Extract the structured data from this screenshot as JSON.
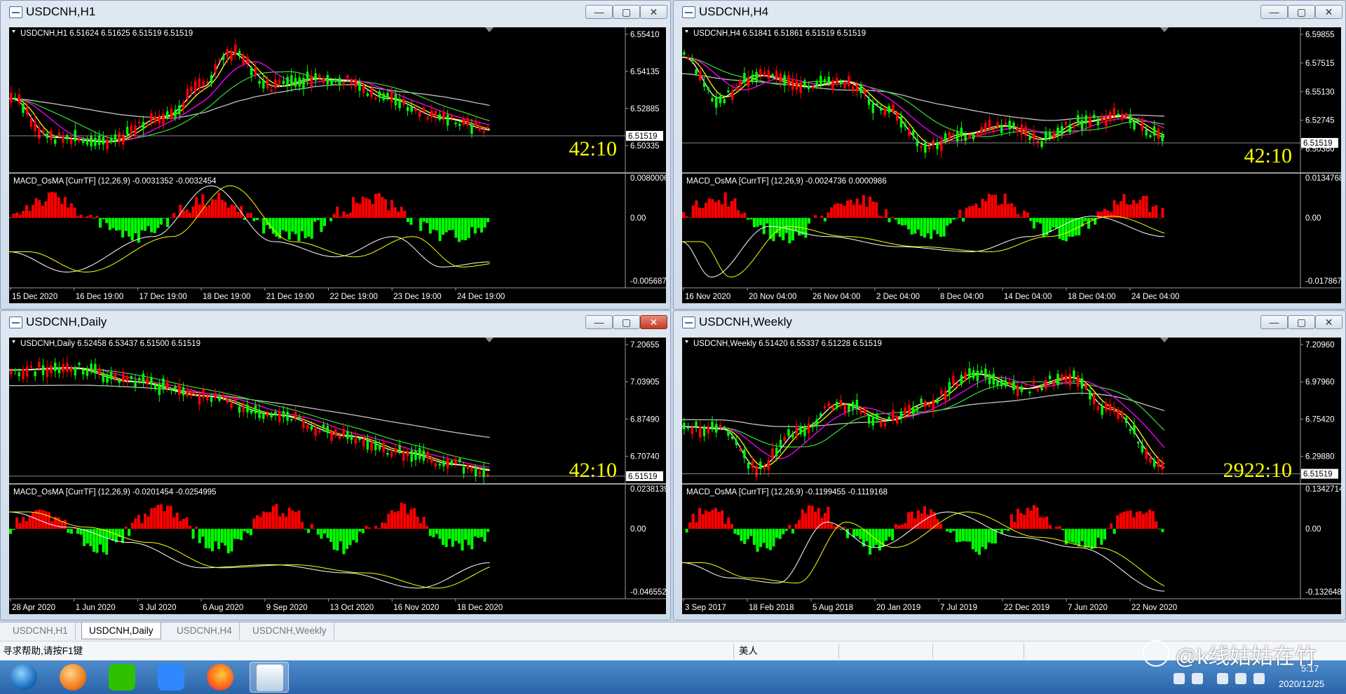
{
  "colors": {
    "bull": "#ff0000",
    "bear": "#00ff00",
    "sma_fast": "#ffffff",
    "sma_yellow": "#ffff00",
    "sma_magenta": "#ff00ff",
    "sma_green": "#32cd32",
    "sma_slow": "#c0c0c0",
    "countdown": "#ffff00"
  },
  "windows": [
    {
      "id": "h1",
      "title": "USDCNH,H1",
      "price_header": "USDCNH,H1  6.51624 6.51625 6.51519 6.51519",
      "price_ticks": [
        "6.55410",
        "6.54135",
        "6.52885",
        "6.50335"
      ],
      "last_price": "6.51519",
      "countdown": "42:10",
      "macd_header": "MACD_OsMA [CurrTF] (12,26,9) -0.0031352 -0.0032454",
      "macd_ticks": [
        "0.0080006",
        "0.00",
        "-0.0056875"
      ],
      "time_labels": [
        "15 Dec 2020",
        "16 Dec 19:00",
        "17 Dec 19:00",
        "18 Dec 19:00",
        "21 Dec 19:00",
        "22 Dec 19:00",
        "23 Dec 19:00",
        "24 Dec 19:00"
      ],
      "close_red": false
    },
    {
      "id": "h4",
      "title": "USDCNH,H4",
      "price_header": "USDCNH,H4  6.51841 6.51861 6.51519 6.51519",
      "price_ticks": [
        "6.59855",
        "6.57515",
        "6.55130",
        "6.52745",
        "6.50360"
      ],
      "last_price": "6.51519",
      "countdown": "42:10",
      "macd_header": "MACD_OsMA [CurrTF] (12,26,9) -0.0024736 0.0000986",
      "macd_ticks": [
        "0.0134768",
        "0.00",
        "-0.0178674"
      ],
      "time_labels": [
        "16 Nov 2020",
        "20 Nov 04:00",
        "26 Nov 04:00",
        "2 Dec 04:00",
        "8 Dec 04:00",
        "14 Dec 04:00",
        "18 Dec 04:00",
        "24 Dec 04:00"
      ],
      "close_red": false
    },
    {
      "id": "daily",
      "title": "USDCNH,Daily",
      "price_header": "USDCNH,Daily  6.52458 6.53437 6.51500 6.51519",
      "price_ticks": [
        "7.20655",
        "7.03905",
        "6.87490",
        "6.70740"
      ],
      "last_price": "6.51519",
      "countdown": "42:10",
      "macd_header": "MACD_OsMA [CurrTF] (12,26,9) -0.0201454 -0.0254995",
      "macd_ticks": [
        "0.0238139",
        "0.00",
        "-0.046552"
      ],
      "time_labels": [
        "28 Apr 2020",
        "1 Jun 2020",
        "3 Jul 2020",
        "6 Aug 2020",
        "9 Sep 2020",
        "13 Oct 2020",
        "16 Nov 2020",
        "18 Dec 2020"
      ],
      "close_red": true
    },
    {
      "id": "weekly",
      "title": "USDCNH,Weekly",
      "price_header": "USDCNH,Weekly  6.51420 6.55337 6.51228 6.51519",
      "price_ticks": [
        "7.20960",
        "6.97960",
        "6.75420",
        "6.29880"
      ],
      "last_price": "6.51519",
      "countdown": "2922:10",
      "macd_header": "MACD_OsMA [CurrTF] (12,26,9) -0.1199455 -0.1119168",
      "macd_ticks": [
        "0.1342714",
        "0.00",
        "-0.132648"
      ],
      "time_labels": [
        "3 Sep 2017",
        "18 Feb 2018",
        "5 Aug 2018",
        "20 Jan 2019",
        "7 Jul 2019",
        "22 Dec 2019",
        "7 Jun 2020",
        "22 Nov 2020"
      ],
      "close_red": false
    }
  ],
  "tabs": [
    {
      "label": "USDCNH,H1",
      "active": false
    },
    {
      "label": "USDCNH,Daily",
      "active": true
    },
    {
      "label": "USDCNH,H4",
      "active": false
    },
    {
      "label": "USDCNH,Weekly",
      "active": false
    }
  ],
  "status": {
    "help_text": "寻求帮助,请按F1键",
    "profile": "美人"
  },
  "taskbar": {
    "apps": [
      "start-orb",
      "sync-app",
      "wechat",
      "feishu-docs",
      "firefox",
      "metatrader"
    ],
    "time": "5:17",
    "date": "2020/12/25"
  },
  "watermark": {
    "text": "@k线姑姑在竹"
  }
}
